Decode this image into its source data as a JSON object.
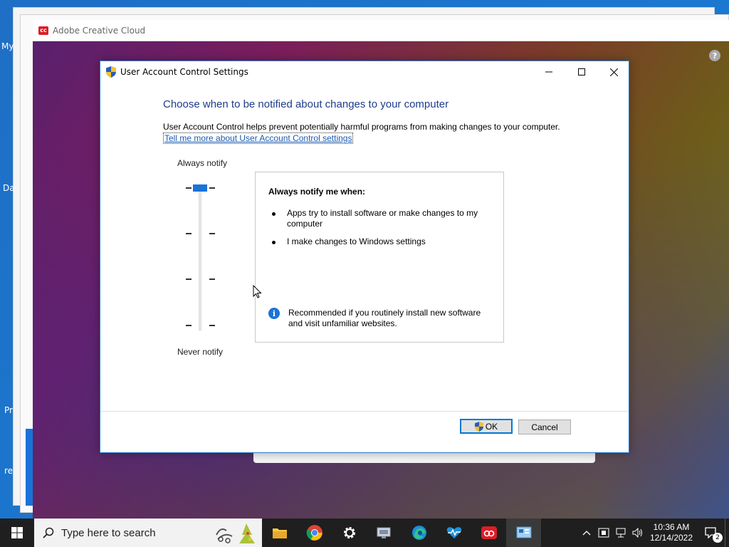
{
  "desktop": {
    "frag_top": "My",
    "frag_mid": "Da",
    "frag_pr": "Pr",
    "frag_re": "re"
  },
  "cc_window": {
    "title": "Adobe Creative Cloud",
    "help_icon": "?"
  },
  "uac": {
    "title": "User Account Control Settings",
    "controls": {
      "minimize": "—",
      "maximize": "☐",
      "close": "✕"
    },
    "heading": "Choose when to be notified about changes to your computer",
    "description": "User Account Control helps prevent potentially harmful programs from making changes to your computer.",
    "link": "Tell me more about User Account Control settings",
    "slider": {
      "top_label": "Always notify",
      "bottom_label": "Never notify",
      "levels": 4,
      "selected_level": 1
    },
    "info": {
      "heading": "Always notify me when:",
      "bullets": [
        "Apps try to install software or make changes to my computer",
        "I make changes to Windows settings"
      ],
      "recommendation": "Recommended if you routinely install new software and visit unfamiliar websites."
    },
    "buttons": {
      "ok": "OK",
      "cancel": "Cancel"
    }
  },
  "taskbar": {
    "search_placeholder": "Type here to search",
    "apps": [
      "file-explorer",
      "chrome",
      "settings",
      "network-tool",
      "edge",
      "health-monitor",
      "creative-cloud",
      "control-panel"
    ],
    "clock": {
      "time": "10:36 AM",
      "date": "12/14/2022"
    },
    "notification_count": "2"
  },
  "colors": {
    "accent": "#0078d7",
    "heading": "#1e3c8c",
    "link": "#1a5ab0",
    "taskbar": "#1f1f1f"
  }
}
